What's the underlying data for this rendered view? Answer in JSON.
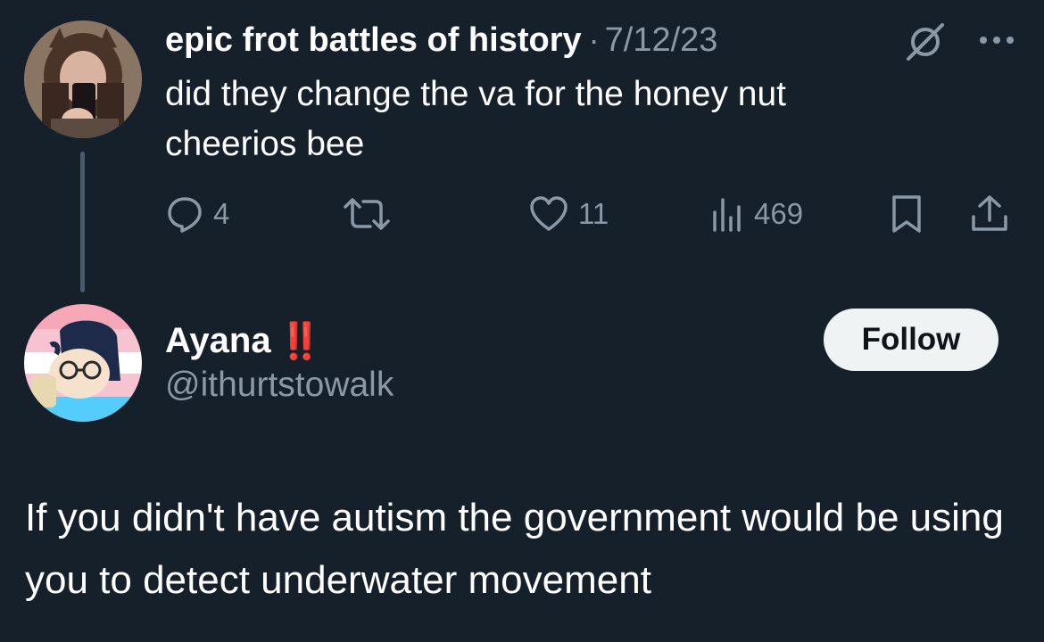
{
  "quoted_tweet": {
    "display_name": "epic frot battles of history",
    "separator": "·",
    "date": "7/12/23",
    "text": "did they change the va for the honey nut cheerios bee",
    "actions": {
      "reply": {
        "icon": "reply-icon",
        "count": "4"
      },
      "retweet": {
        "icon": "retweet-icon",
        "count": ""
      },
      "like": {
        "icon": "heart-icon",
        "count": "11"
      },
      "views": {
        "icon": "views-icon",
        "count": "469"
      },
      "bookmark": {
        "icon": "bookmark-icon"
      },
      "share": {
        "icon": "share-icon"
      }
    },
    "header_icons": [
      "grok-icon",
      "more-options-icon"
    ]
  },
  "reply_tweet": {
    "display_name": "Ayana",
    "name_emoji": "‼️",
    "handle": "@ithurtstowalk",
    "follow_label": "Follow",
    "text": "If you didn't have autism the government would be using you to detect underwater movement"
  },
  "colors": {
    "background": "#15202b",
    "primary_text": "#ffffff",
    "secondary_text": "#8b98a5",
    "follow_button_bg": "#eff3f4",
    "follow_button_text": "#0f1419",
    "emoji_red": "#e81c1c"
  }
}
